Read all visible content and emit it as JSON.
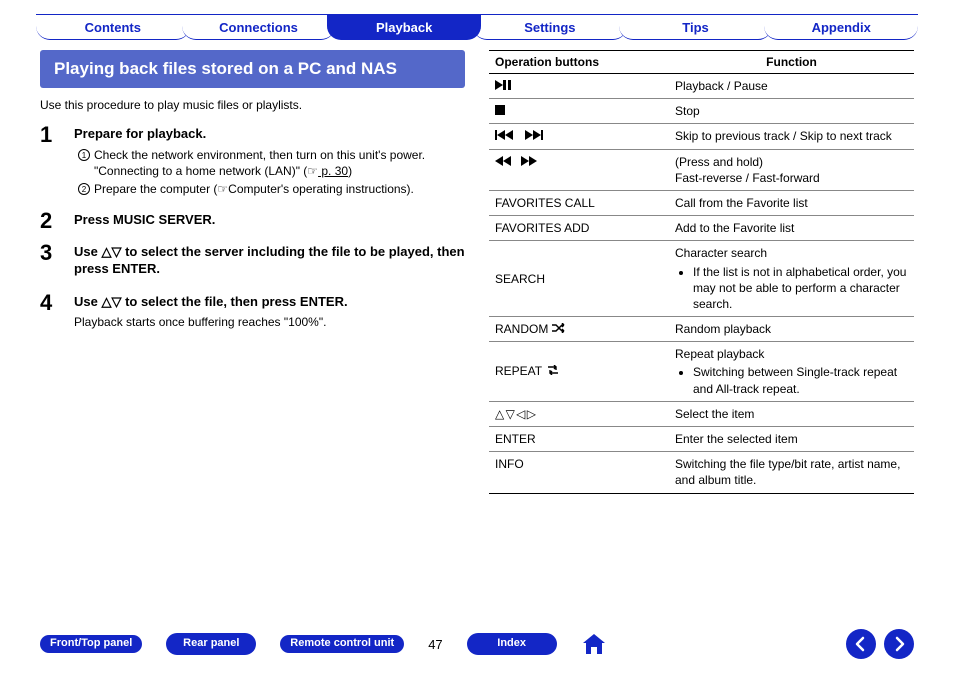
{
  "tabs": {
    "contents": "Contents",
    "connections": "Connections",
    "playback": "Playback",
    "settings": "Settings",
    "tips": "Tips",
    "appendix": "Appendix"
  },
  "section_title": "Playing back files stored on a PC and NAS",
  "intro": "Use this procedure to play music files or playlists.",
  "steps": {
    "s1": {
      "num": "1",
      "head": "Prepare for playback.",
      "sub1_pre": "Check the network environment, then turn on this unit's power. \"Connecting to a home network (LAN)\" (",
      "sub1_link": " p. 30",
      "sub1_post": ")",
      "sub2_pre": "Prepare the computer (",
      "sub2_post": "Computer's operating instructions)."
    },
    "s2": {
      "num": "2",
      "head": "Press MUSIC SERVER."
    },
    "s3": {
      "num": "3",
      "head": "Use △▽ to select the server including the file to be played, then press ENTER."
    },
    "s4": {
      "num": "4",
      "head": "Use △▽ to select the file, then press ENTER.",
      "note": "Playback starts once buffering reaches \"100%\"."
    }
  },
  "table": {
    "h1": "Operation buttons",
    "h2": "Function",
    "rows": {
      "r0": {
        "func": "Playback / Pause"
      },
      "r1": {
        "func": "Stop"
      },
      "r2": {
        "func": "Skip to previous track / Skip to next track"
      },
      "r3": {
        "line1": "(Press and hold)",
        "line2": "Fast-reverse / Fast-forward"
      },
      "r4": {
        "op": "FAVORITES CALL",
        "func": "Call from the Favorite list"
      },
      "r5": {
        "op": "FAVORITES ADD",
        "func": "Add to the Favorite list"
      },
      "r6": {
        "op": "SEARCH",
        "line1": "Character search",
        "bullet": "If the list is not in alphabetical order, you may not be able to perform a character search."
      },
      "r7": {
        "op": "RANDOM ",
        "func": "Random playback"
      },
      "r8": {
        "op": "REPEAT ",
        "line1": "Repeat playback",
        "bullet": "Switching between Single-track repeat and All-track repeat."
      },
      "r9": {
        "func": "Select the item"
      },
      "r10": {
        "op": "ENTER",
        "func": "Enter the selected item"
      },
      "r11": {
        "op": "INFO",
        "func": "Switching the file type/bit rate, artist name, and album title."
      }
    }
  },
  "footer": {
    "front_top": "Front/Top panel",
    "rear": "Rear panel",
    "remote": "Remote control unit",
    "page": "47",
    "index": "Index"
  }
}
